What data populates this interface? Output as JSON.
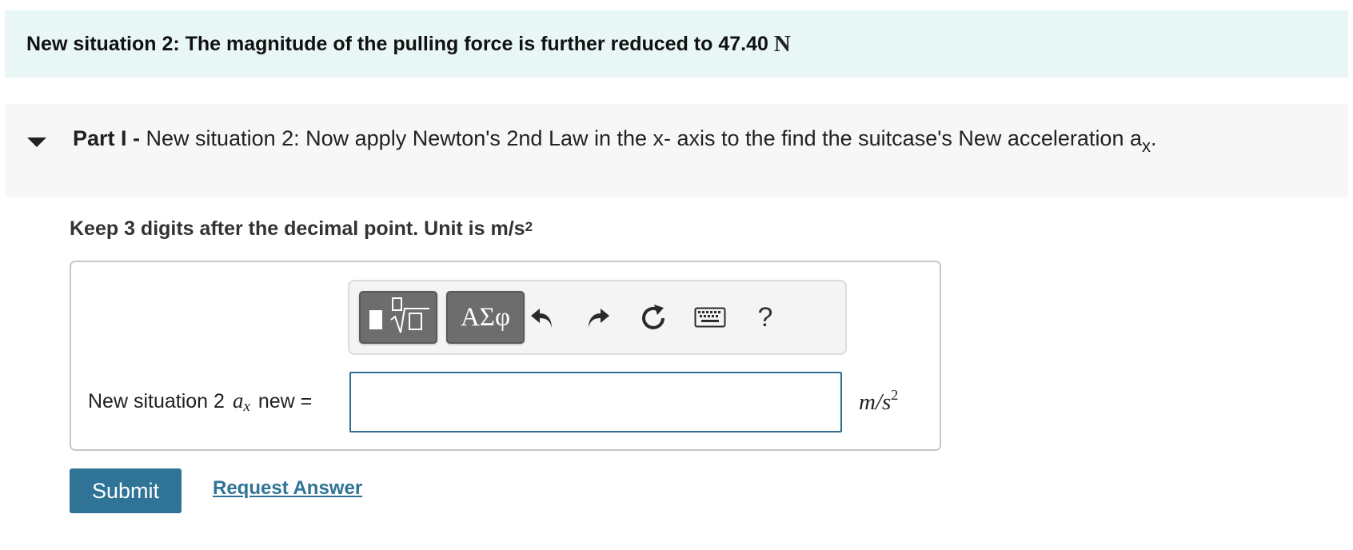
{
  "banner": {
    "text": "New situation 2: The magnitude of the pulling force is further reduced to 47.40",
    "unit": "N"
  },
  "part": {
    "label": "Part I -",
    "text": " New situation 2: Now apply Newton's 2nd Law in the x- axis to the find the suitcase's New acceleration a",
    "subscript": "x",
    "end": "."
  },
  "instruction": {
    "text": "Keep 3 digits after the decimal point. Unit is m/s",
    "sup": "2"
  },
  "toolbar": {
    "templates_icon": "fraction-sqrt-templates-icon",
    "symbols_label": "ΑΣφ",
    "undo_icon": "undo-icon",
    "redo_icon": "redo-icon",
    "reset_icon": "reset-icon",
    "keyboard_icon": "keyboard-icon",
    "help_label": "?"
  },
  "equation": {
    "prefix": "New situation 2",
    "var": "a",
    "var_sub": "x",
    "suffix": "new ="
  },
  "answer": {
    "value": "",
    "placeholder": ""
  },
  "unit": {
    "base": "m/s",
    "sup": "2"
  },
  "actions": {
    "submit_label": "Submit",
    "request_label": "Request Answer"
  },
  "colors": {
    "banner_bg": "#e8f6f6",
    "part_header_bg": "#f7f7f7",
    "accent": "#2f7397",
    "input_border": "#2f6e8f",
    "toolbar_button": "#6d6d6d"
  }
}
